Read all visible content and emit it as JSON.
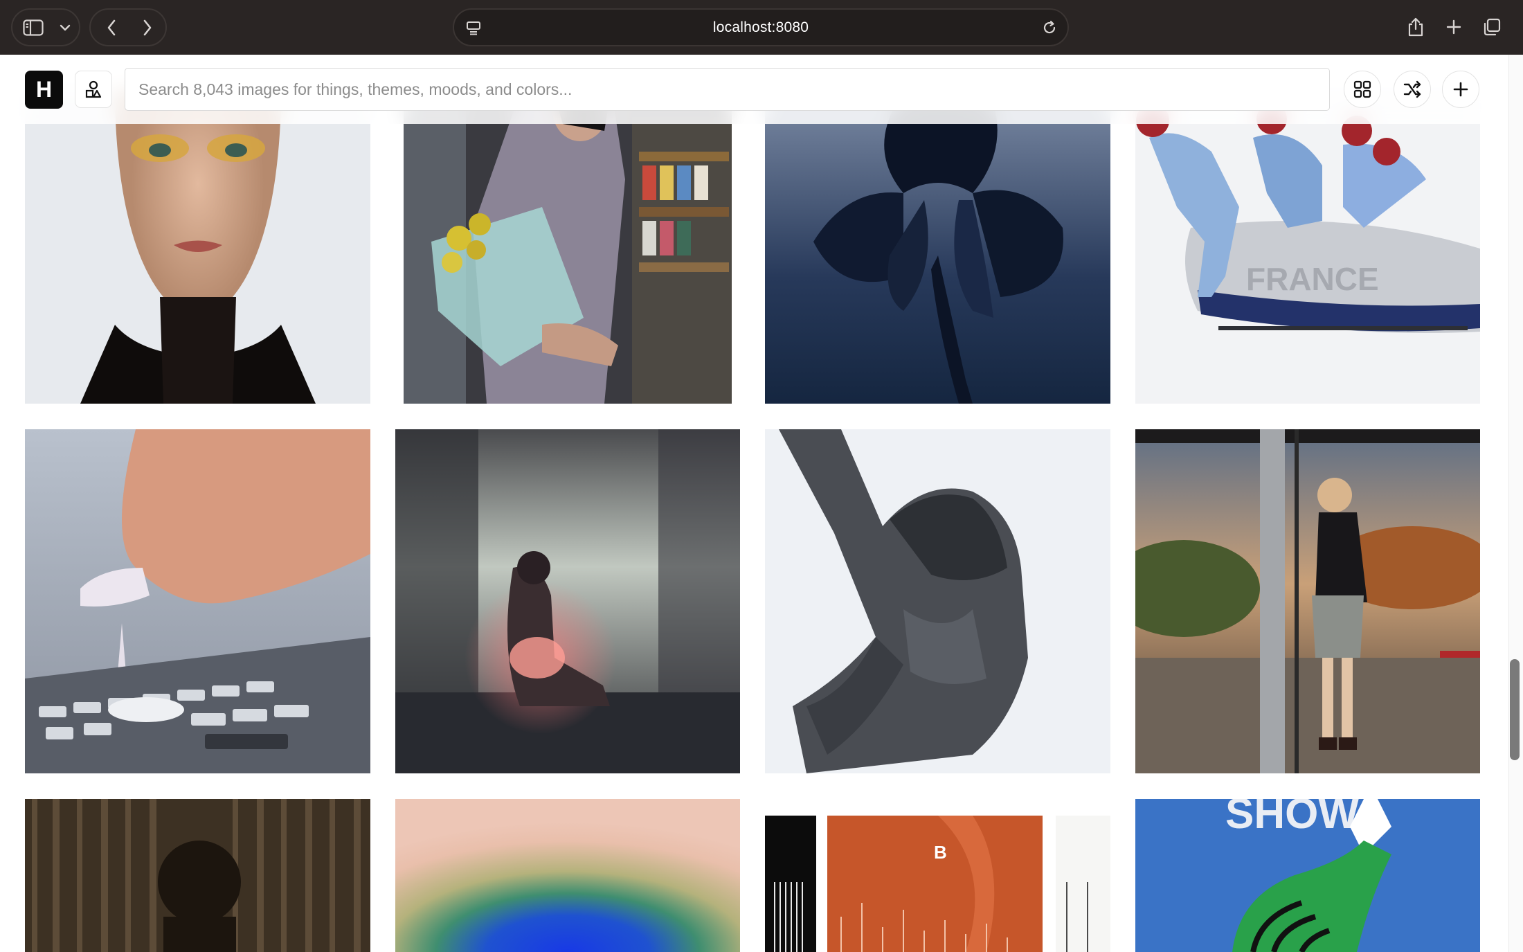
{
  "browser": {
    "url": "localhost:8080",
    "icons": [
      "sidebar-icon",
      "chevron-down-icon",
      "back-icon",
      "forward-icon",
      "page-menu-icon",
      "reload-icon",
      "share-icon",
      "new-tab-icon",
      "tab-overview-icon"
    ]
  },
  "app": {
    "logo": "H",
    "search_placeholder": "Search 8,043 images for things, themes, moods, and colors...",
    "tools": [
      "shapes-icon",
      "grid-view-icon",
      "shuffle-icon",
      "add-icon"
    ]
  },
  "gallery": {
    "tiles": [
      {
        "subject": "portrait with gold eyeshadow",
        "colors": [
          "#e9ecef",
          "#c9a48a",
          "#1a1412"
        ]
      },
      {
        "subject": "woman with flower bouquet in store",
        "colors": [
          "#6b6a6f",
          "#b0b8b7",
          "#2c2a2e"
        ]
      },
      {
        "subject": "dark blue iris flower",
        "colors": [
          "#5f7391",
          "#1f2c44",
          "#0a1020"
        ]
      },
      {
        "subject": "bobsleigh team",
        "colors": [
          "#f3f4f6",
          "#7fa2cf",
          "#1d2c5a"
        ]
      },
      {
        "subject": "hand with long nail pressing keys",
        "colors": [
          "#c6ccd6",
          "#d9a48c",
          "#63666e"
        ]
      },
      {
        "subject": "figure glowing red on bed",
        "colors": [
          "#b9bbb6",
          "#c7505a",
          "#2f3035"
        ]
      },
      {
        "subject": "grey hoodie figure",
        "colors": [
          "#eef1f4",
          "#55585d",
          "#2a2c30"
        ]
      },
      {
        "subject": "woman at bus stop",
        "colors": [
          "#6d7f86",
          "#b06d3c",
          "#2d2622"
        ]
      },
      {
        "subject": "figure behind curtain",
        "colors": [
          "#5a4a35",
          "#2b2218",
          "#141008"
        ]
      },
      {
        "subject": "gradient orb",
        "colors": [
          "#e8c0ad",
          "#3f8f6e",
          "#1b40d9"
        ]
      },
      {
        "subject": "orange poster B",
        "colors": [
          "#f4f4f2",
          "#c55b2c",
          "#111111"
        ]
      },
      {
        "subject": "blue poster with green shape",
        "colors": [
          "#3a73c6",
          "#27a24b",
          "#ffffff"
        ]
      }
    ]
  }
}
